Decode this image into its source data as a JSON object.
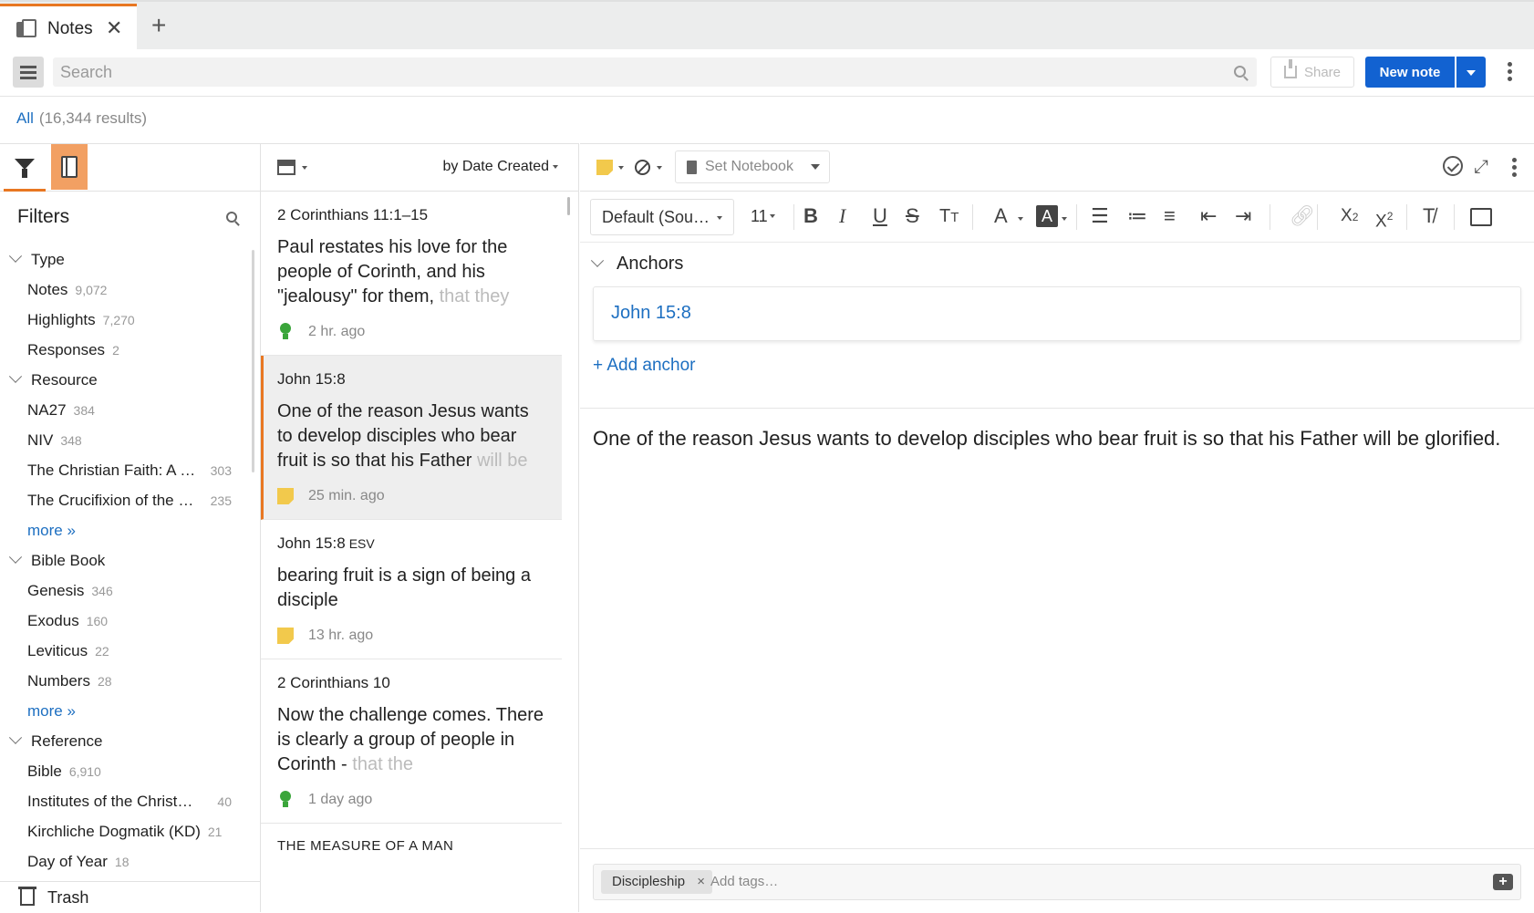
{
  "tab": {
    "title": "Notes",
    "close": "✕",
    "add": "+"
  },
  "toolbar": {
    "search_placeholder": "Search",
    "share_label": "Share",
    "new_note_label": "New note"
  },
  "results": {
    "scope": "All",
    "count": "(16,344 results)"
  },
  "filters": {
    "title": "Filters",
    "groups": [
      {
        "label": "Type",
        "items": [
          {
            "label": "Notes",
            "count": "9,072"
          },
          {
            "label": "Highlights",
            "count": "7,270"
          },
          {
            "label": "Responses",
            "count": "2"
          }
        ]
      },
      {
        "label": "Resource",
        "items": [
          {
            "label": "NA27",
            "count": "384"
          },
          {
            "label": "NIV",
            "count": "348"
          },
          {
            "label": "The Christian Faith: A …",
            "count": "303"
          },
          {
            "label": "The Crucifixion of the …",
            "count": "235"
          }
        ],
        "more": "more »"
      },
      {
        "label": "Bible Book",
        "items": [
          {
            "label": "Genesis",
            "count": "346"
          },
          {
            "label": "Exodus",
            "count": "160"
          },
          {
            "label": "Leviticus",
            "count": "22"
          },
          {
            "label": "Numbers",
            "count": "28"
          }
        ],
        "more": "more »"
      },
      {
        "label": "Reference",
        "items": [
          {
            "label": "Bible",
            "count": "6,910"
          },
          {
            "label": "Institutes of the Christi…",
            "count": "40"
          },
          {
            "label": "Kirchliche Dogmatik (KD)",
            "count": "21"
          },
          {
            "label": "Day of Year",
            "count": "18"
          }
        ]
      }
    ],
    "trash": "Trash"
  },
  "list": {
    "sort": "by Date Created",
    "notes": [
      {
        "ref": "2 Corinthians 11:1–15",
        "ref_small": "",
        "body": "Paul restates his love for the people of Corinth, and his \"jealousy\" for them,",
        "body_fade": " that they",
        "icon": "bulb-icon",
        "time": "2 hr. ago",
        "selected": false
      },
      {
        "ref": "John 15:8",
        "ref_small": "",
        "body": "One of the reason Jesus wants to develop disciples who bear fruit is so that his Father",
        "body_fade": " will be",
        "icon": "sticky-note-icon",
        "time": "25 min. ago",
        "selected": true
      },
      {
        "ref": "John 15:8",
        "ref_small": "ESV",
        "body": "bearing fruit is a sign of being a disciple",
        "body_fade": "",
        "icon": "sticky-note-icon",
        "time": "13 hr. ago",
        "selected": false
      },
      {
        "ref": "2 Corinthians 10",
        "ref_small": "",
        "body": "Now the challenge comes. There is clearly a group of people in Corinth -",
        "body_fade": " that the",
        "icon": "bulb-icon",
        "time": "1 day ago",
        "selected": false
      },
      {
        "ref": "THE MEASURE OF A MAN",
        "ref_small": "",
        "body": "",
        "body_fade": "",
        "icon": "",
        "time": "",
        "selected": false
      }
    ]
  },
  "editor": {
    "set_notebook": "Set Notebook",
    "font": "Default (Sou…",
    "size": "11",
    "anchors_title": "Anchors",
    "anchor": "John 15:8",
    "add_anchor": "+ Add anchor",
    "content": "One of the reason Jesus wants to develop disciples who bear fruit is so that his Father will be glorified.",
    "tags": [
      {
        "label": "Discipleship"
      }
    ],
    "tag_placeholder": "Add tags…"
  },
  "colors": {
    "accent": "#e87722",
    "primary": "#1262d1",
    "link": "#1d6fc1",
    "note_yellow": "#f2c94c",
    "bulb_green": "#3aa53a"
  }
}
